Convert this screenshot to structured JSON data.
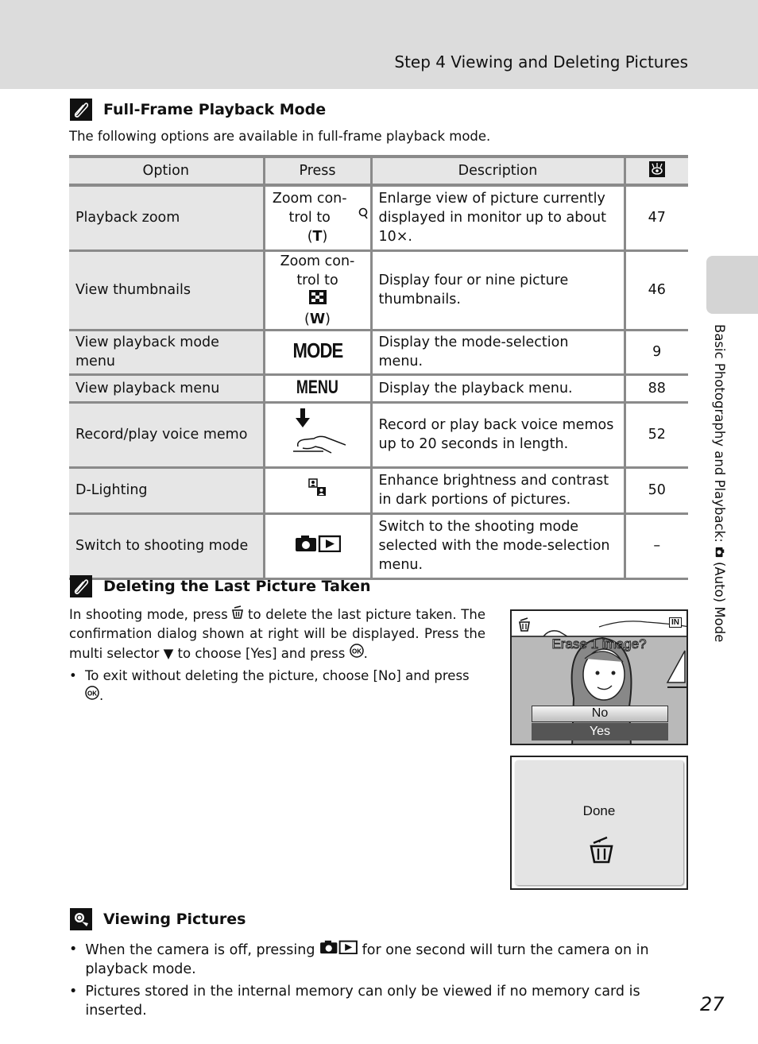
{
  "header": {
    "title": "Step 4 Viewing and Deleting Pictures"
  },
  "side_tab": {
    "text_before": "Basic Photography and Playback:",
    "icon": "camera-auto-icon",
    "text_after": "(Auto) Mode"
  },
  "section_playback": {
    "icon": "pencil-note-icon",
    "heading": "Full-Frame Playback Mode",
    "intro": "The following options are available in full-frame playback mode.",
    "table": {
      "headers": [
        "Option",
        "Press",
        "Description",
        "page-reference-icon"
      ],
      "rows": [
        {
          "option": "Playback zoom",
          "press": "Zoom con-trol to",
          "press_icon": "zoom-tele-icon",
          "press_suffix": "T",
          "description": "Enlarge view of picture currently displayed in monitor up to about 10×.",
          "page": "47"
        },
        {
          "option": "View thumbnails",
          "press": "Zoom con-trol to",
          "press_icon": "thumbnail-grid-icon",
          "press_suffix": "W",
          "description": "Display four or nine picture thumbnails.",
          "page": "46"
        },
        {
          "option": "View playback mode menu",
          "press": "MODE",
          "press_icon": "mode-button-icon",
          "description": "Display the mode-selection menu.",
          "page": "9"
        },
        {
          "option": "View playback menu",
          "press": "MENU",
          "press_icon": "menu-button-icon",
          "description": "Display the playback menu.",
          "page": "88"
        },
        {
          "option": "Record/play voice memo",
          "press_icon": "shutter-press-icon",
          "description": "Record or play back voice memos up to 20 seconds in length.",
          "page": "52"
        },
        {
          "option": "D-Lighting",
          "press_icon": "d-lighting-icon",
          "description": "Enhance brightness and contrast in dark portions of pictures.",
          "page": "50"
        },
        {
          "option": "Switch to shooting mode",
          "press_icon": "camera-playback-icon",
          "description": "Switch to the shooting mode selected with the mode-selection menu.",
          "page": "–"
        }
      ]
    }
  },
  "section_delete": {
    "icon": "pencil-note-icon",
    "heading": "Deleting the Last Picture Taken",
    "para_1": "In shooting mode, press",
    "para_2": "to delete the last picture taken. The confirmation dialog shown at right will be displayed. Press the multi selector",
    "para_3": "to choose [Yes] and press",
    "bullet_1": "To exit without deleting the picture, choose [No] and press",
    "screen_confirm": {
      "prompt": "Erase 1 image?",
      "memory": "IN",
      "options": [
        "No",
        "Yes"
      ],
      "selected": "Yes"
    },
    "screen_done": {
      "label": "Done"
    }
  },
  "section_viewing": {
    "icon": "viewing-tip-icon",
    "heading": "Viewing Pictures",
    "bullet_1_a": "When the camera is off, pressing",
    "bullet_1_b": "for one second will turn the camera on in playback mode.",
    "bullet_2": "Pictures stored in the internal memory can only be viewed if no memory card is inserted."
  },
  "page_number": "27"
}
